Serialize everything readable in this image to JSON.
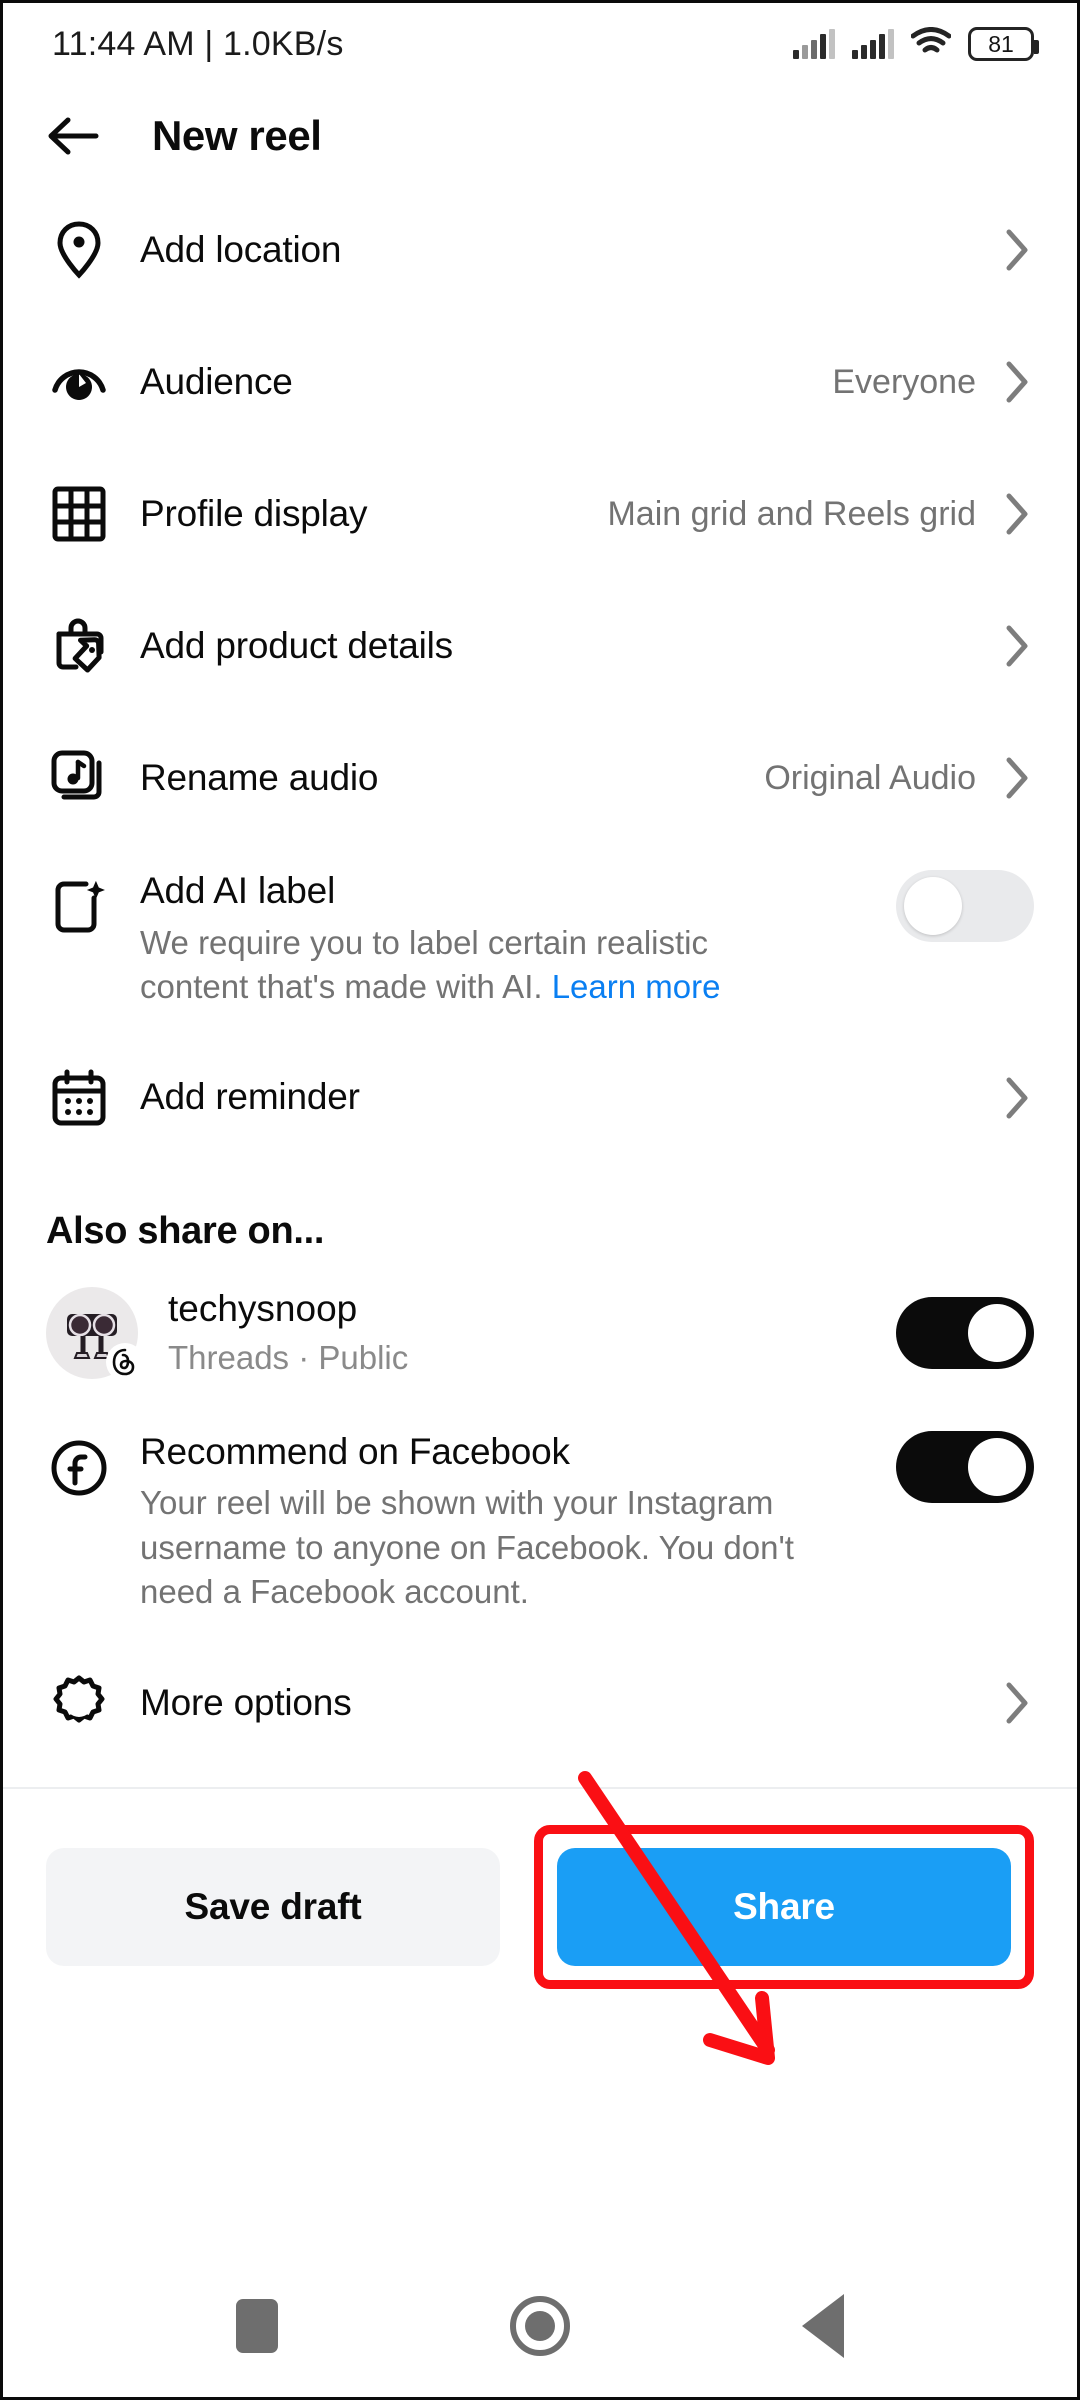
{
  "status_bar": {
    "time_and_speed": "11:44 AM | 1.0KB/s",
    "battery_level": "81",
    "icons": [
      "signal-bars-icon",
      "signal-bars-icon",
      "wifi-icon",
      "battery-icon"
    ]
  },
  "header": {
    "back_label": "back-arrow",
    "title": "New reel"
  },
  "rows": [
    {
      "label": "Add location",
      "value": "",
      "icon": "location-pin-icon"
    },
    {
      "label": "Audience",
      "value": "Everyone",
      "icon": "audience-eye-icon"
    },
    {
      "label": "Profile display",
      "value": "Main grid and Reels grid",
      "icon": "grid-icon"
    },
    {
      "label": "Add product details",
      "value": "",
      "icon": "product-tag-icon"
    },
    {
      "label": "Rename audio",
      "value": "Original Audio",
      "icon": "audio-note-icon"
    }
  ],
  "ai_label": {
    "label": "Add AI label",
    "description_text": "We require you to label certain realistic content that's made with AI. ",
    "link_text": "Learn more",
    "icon": "ai-sparkle-icon",
    "toggle_on": false
  },
  "reminder": {
    "label": "Add reminder",
    "icon": "calendar-icon"
  },
  "also_share": {
    "section_title": "Also share on...",
    "accounts": [
      {
        "name": "techysnoop",
        "meta": "Threads · Public",
        "avatar": "threads-avatar",
        "badge_icon": "threads-badge-icon",
        "toggle_on": true
      }
    ],
    "facebook": {
      "label": "Recommend on Facebook",
      "description": "Your reel will be shown with your Instagram username to anyone on Facebook. You don't need a Facebook account.",
      "icon": "facebook-icon",
      "toggle_on": true
    }
  },
  "more_options": {
    "label": "More options",
    "icon": "gear-icon"
  },
  "actions": {
    "save_draft_label": "Save draft",
    "share_label": "Share"
  },
  "nav_bar": {
    "recents": "square-recents-icon",
    "home": "circle-home-icon",
    "back": "triangle-back-icon"
  },
  "annotation": {
    "highlight_color": "#fa0f14",
    "arrow": "red-arrow-pointing-to-share-button"
  },
  "colors": {
    "share_blue": "#1a9ef5",
    "link_blue": "#0a7ff2",
    "toggle_on": "#0b0b0b",
    "toggle_off": "#e9eaec",
    "muted_text": "#737373",
    "annotation_red": "#fa0f14"
  }
}
